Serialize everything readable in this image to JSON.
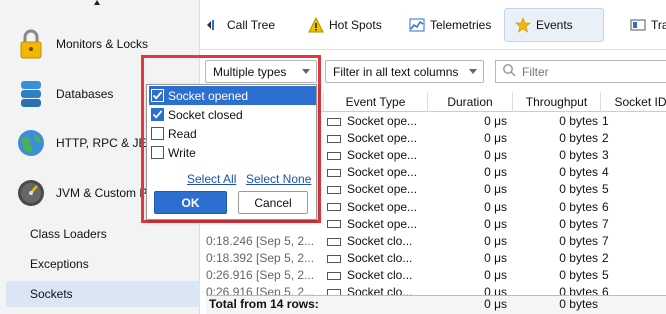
{
  "sidebar": {
    "items": [
      {
        "label": "Monitors & Locks",
        "icon": "padlock-icon"
      },
      {
        "label": "Databases",
        "icon": "database-icon"
      },
      {
        "label": "HTTP, RPC & JEE",
        "icon": "globe-icon"
      },
      {
        "label": "JVM & Custom Probes",
        "icon": "gauge-icon"
      }
    ],
    "subitems": [
      "Class Loaders",
      "Exceptions",
      "Sockets"
    ],
    "selected": "Sockets"
  },
  "tabs": [
    {
      "label": "Call Tree",
      "icon": "call-tree-icon"
    },
    {
      "label": "Hot Spots",
      "icon": "warning-icon"
    },
    {
      "label": "Telemetries",
      "icon": "telemetries-icon"
    },
    {
      "label": "Events",
      "icon": "star-icon",
      "active": true
    },
    {
      "label": "Tra",
      "icon": "tracker-icon"
    }
  ],
  "toolbar": {
    "type_dropdown": "Multiple types",
    "filter_mode_dropdown": "Filter in all text columns",
    "filter_placeholder": "Filter"
  },
  "popup": {
    "options": [
      {
        "label": "Socket opened",
        "checked": true,
        "highlighted": true
      },
      {
        "label": "Socket closed",
        "checked": true,
        "highlighted": false
      },
      {
        "label": "Read",
        "checked": false,
        "highlighted": false
      },
      {
        "label": "Write",
        "checked": false,
        "highlighted": false
      }
    ],
    "select_all": "Select All",
    "select_none": "Select None",
    "ok": "OK",
    "cancel": "Cancel"
  },
  "table": {
    "columns": [
      "Event Type",
      "Duration",
      "Throughput",
      "Socket ID"
    ],
    "rows": [
      {
        "time": "",
        "event": "Socket ope...",
        "duration": "0 μs",
        "throughput": "0 bytes",
        "id": "1"
      },
      {
        "time": "",
        "event": "Socket ope...",
        "duration": "0 μs",
        "throughput": "0 bytes",
        "id": "2"
      },
      {
        "time": "",
        "event": "Socket ope...",
        "duration": "0 μs",
        "throughput": "0 bytes",
        "id": "3"
      },
      {
        "time": "",
        "event": "Socket ope...",
        "duration": "0 μs",
        "throughput": "0 bytes",
        "id": "4"
      },
      {
        "time": "",
        "event": "Socket ope...",
        "duration": "0 μs",
        "throughput": "0 bytes",
        "id": "5"
      },
      {
        "time": "",
        "event": "Socket ope...",
        "duration": "0 μs",
        "throughput": "0 bytes",
        "id": "6"
      },
      {
        "time": "",
        "event": "Socket ope...",
        "duration": "0 μs",
        "throughput": "0 bytes",
        "id": "7"
      },
      {
        "time": "0:18.246 [Sep 5, 2...",
        "event": "Socket clo...",
        "duration": "0 μs",
        "throughput": "0 bytes",
        "id": "7"
      },
      {
        "time": "0:18.392 [Sep 5, 2...",
        "event": "Socket clo...",
        "duration": "0 μs",
        "throughput": "0 bytes",
        "id": "2"
      },
      {
        "time": "0:26.916 [Sep 5, 2...",
        "event": "Socket clo...",
        "duration": "0 μs",
        "throughput": "0 bytes",
        "id": "5"
      },
      {
        "time": "0:26.916 [Sep 5, 2...",
        "event": "Socket clo...",
        "duration": "0 μs",
        "throughput": "0 bytes",
        "id": "6"
      }
    ],
    "total_label": "Total from 14 rows:",
    "total_duration": "0 μs",
    "total_throughput": "0 bytes"
  }
}
